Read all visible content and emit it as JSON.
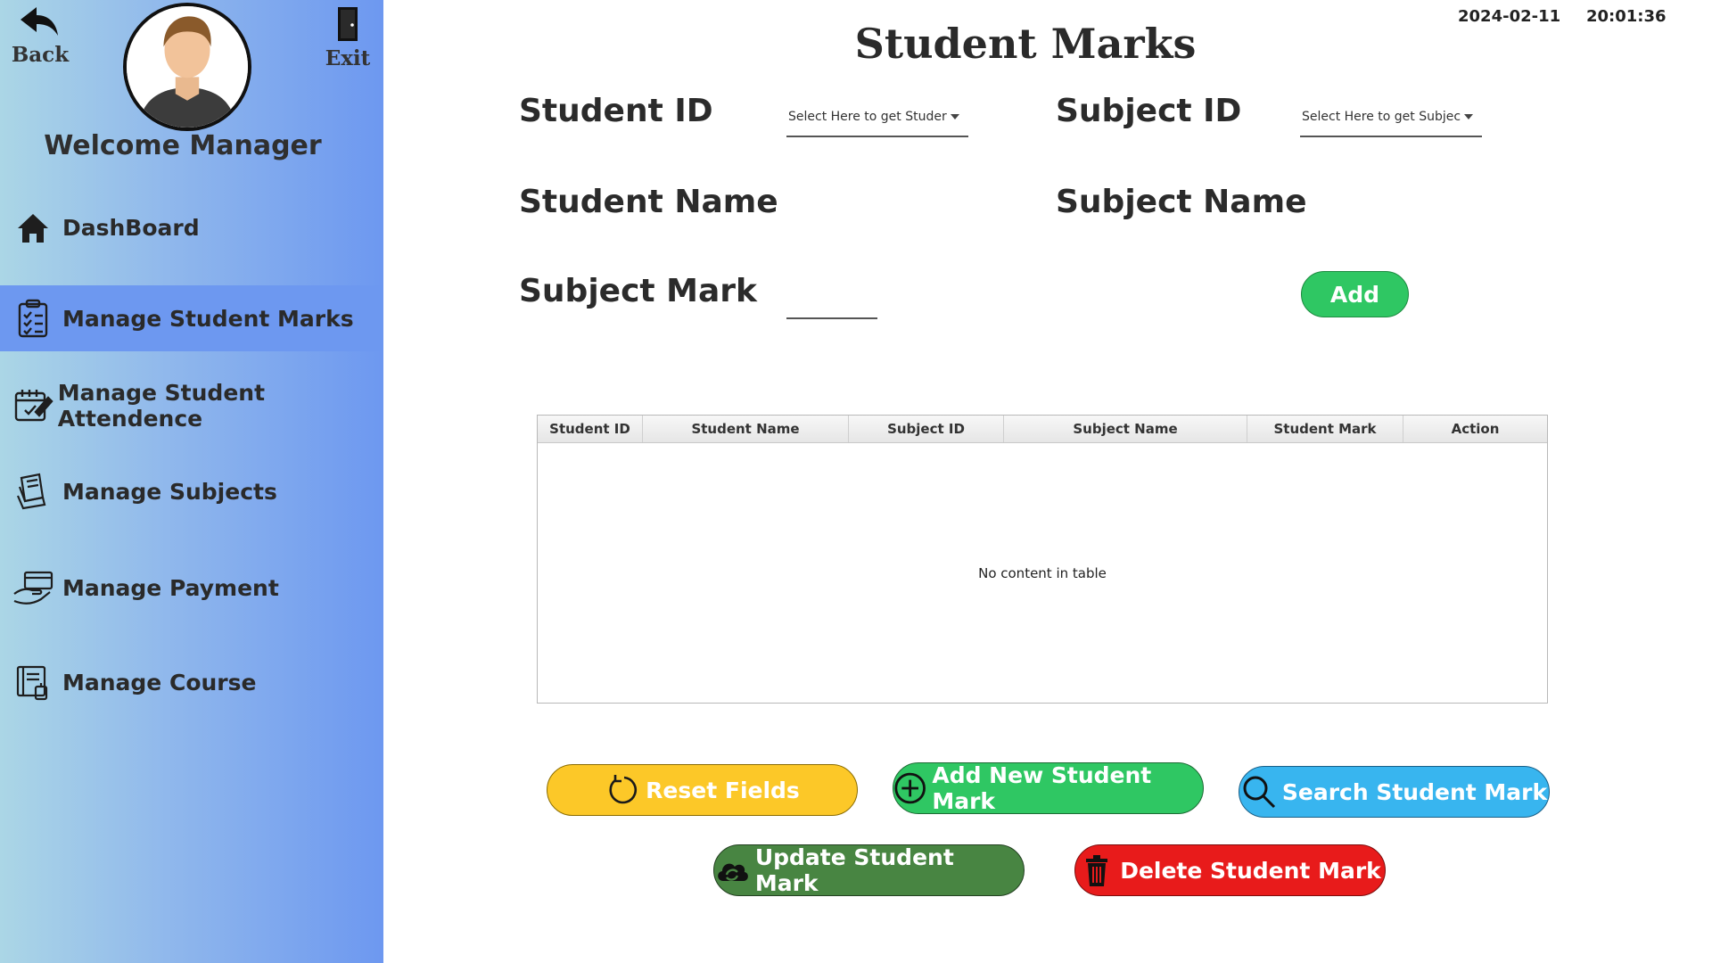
{
  "sidebar": {
    "back_label": "Back",
    "exit_label": "Exit",
    "welcome": "Welcome Manager",
    "items": [
      {
        "label": "DashBoard",
        "icon": "home-icon"
      },
      {
        "label": "Manage Student Marks",
        "icon": "clipboard-checklist-icon"
      },
      {
        "label": "Manage Student Attendence",
        "icon": "calendar-edit-icon"
      },
      {
        "label": "Manage Subjects",
        "icon": "books-icon"
      },
      {
        "label": "Manage Payment",
        "icon": "hand-payment-icon"
      },
      {
        "label": "Manage Course",
        "icon": "course-book-icon"
      }
    ],
    "active_item": "Manage Student Marks"
  },
  "header": {
    "date": "2024-02-11",
    "time": "20:01:36",
    "title": "Student Marks"
  },
  "form": {
    "student_id_label": "Student ID",
    "student_id_placeholder": "Select Here to get Studer",
    "subject_id_label": "Subject ID",
    "subject_id_placeholder": "Select Here to get Subjec",
    "student_name_label": "Student Name",
    "subject_name_label": "Subject Name",
    "subject_mark_label": "Subject Mark",
    "subject_mark_value": "",
    "add_label": "Add"
  },
  "table": {
    "columns": [
      "Student ID",
      "Student Name",
      "Subject ID",
      "Subject Name",
      "Student Mark",
      "Action"
    ],
    "rows": [],
    "empty_text": "No content in table"
  },
  "actions": {
    "reset": "Reset Fields",
    "add_new": "Add New Student Mark",
    "search": "Search Student Mark",
    "update": "Update Student Mark",
    "delete": "Delete Student Mark"
  },
  "colors": {
    "sidebar_start": "#abd6e6",
    "sidebar_end": "#6d98f0",
    "reset": "#fcc828",
    "add": "#2fc763",
    "search": "#38b5ef",
    "update": "#488542",
    "delete": "#e81b1b"
  }
}
